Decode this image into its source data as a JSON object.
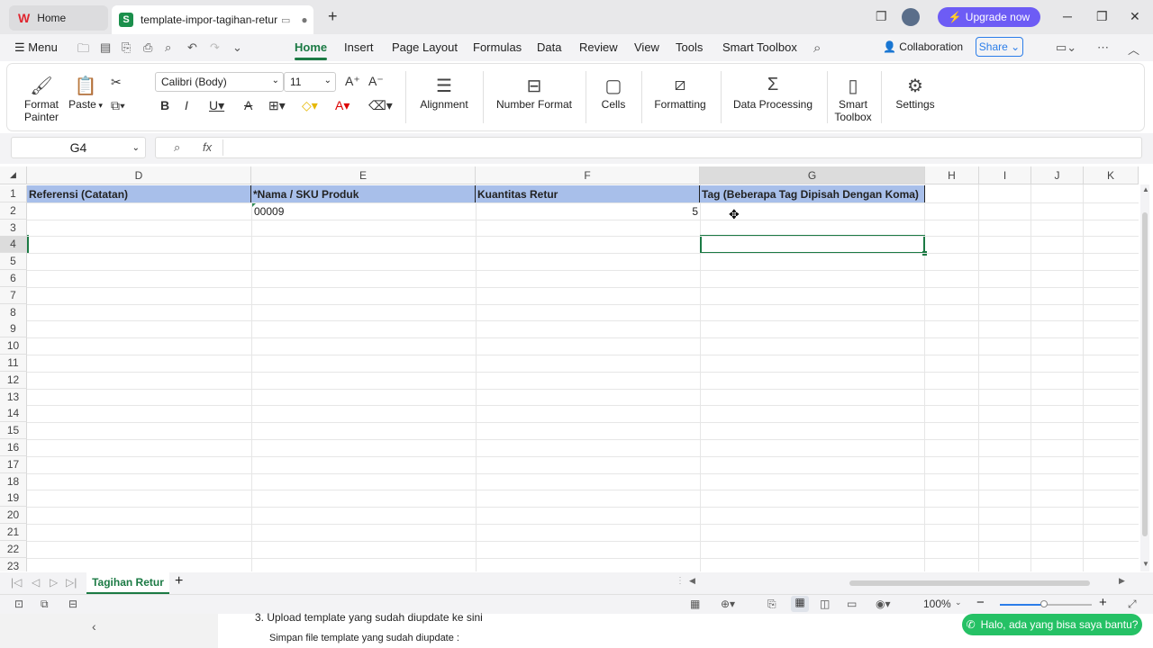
{
  "tabs": {
    "home": "Home",
    "doc": "template-impor-tagihan-retur"
  },
  "titlebar": {
    "upgrade": "Upgrade now"
  },
  "menu": {
    "menu_label": "Menu",
    "items": [
      "Home",
      "Insert",
      "Page Layout",
      "Formulas",
      "Data",
      "Review",
      "View",
      "Tools",
      "Smart Toolbox"
    ],
    "collaboration": "Collaboration",
    "share": "Share"
  },
  "ribbon": {
    "format_painter": "Format Painter",
    "paste": "Paste",
    "font_name": "Calibri (Body)",
    "font_size": "11",
    "alignment": "Alignment",
    "number_format": "Number Format",
    "cells": "Cells",
    "formatting": "Formatting",
    "data_processing": "Data Processing",
    "smart_toolbox": "Smart Toolbox",
    "settings": "Settings"
  },
  "formula_bar": {
    "cell_ref": "G4",
    "fx": "fx",
    "value": ""
  },
  "grid": {
    "columns": [
      "D",
      "E",
      "F",
      "G",
      "H",
      "I",
      "J",
      "K"
    ],
    "rows": [
      "1",
      "2",
      "3",
      "4",
      "5",
      "6",
      "7",
      "8",
      "9",
      "10",
      "11",
      "12",
      "13",
      "14",
      "15",
      "16",
      "17",
      "18",
      "19",
      "20",
      "21",
      "22",
      "23"
    ],
    "header_cells": [
      "Referensi (Catatan)",
      "*Nama / SKU Produk",
      "Kuantitas Retur",
      "Tag (Beberapa Tag Dipisah Dengan Koma)"
    ],
    "row2": {
      "E": "00009",
      "F": "5"
    }
  },
  "sheet": {
    "active_tab": "Tagihan Retur"
  },
  "status": {
    "zoom": "100%"
  },
  "bottom": {
    "step_text": "3. Upload template yang sudah diupdate ke sini",
    "sub_text": "Simpan file template yang sudah diupdate :",
    "whatsapp": "Halo, ada yang bisa saya bantu?"
  }
}
